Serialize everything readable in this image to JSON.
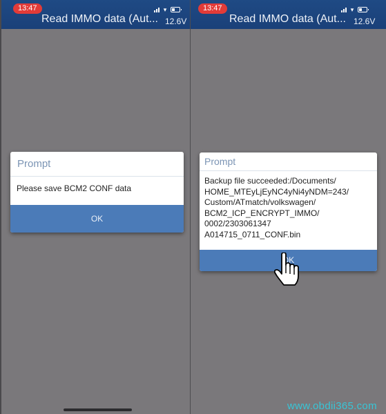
{
  "screens": [
    {
      "status": {
        "time": "13:47",
        "voltage": "12.6V",
        "icons": [
          "signal-icon",
          "wifi-icon",
          "battery-icon"
        ]
      },
      "header": {
        "title": "Read IMMO data (Aut..."
      },
      "dialog": {
        "title": "Prompt",
        "message": "Please save BCM2 CONF data",
        "ok_label": "OK"
      }
    },
    {
      "status": {
        "time": "13:47",
        "voltage": "12.6V",
        "icons": [
          "signal-icon",
          "wifi-icon",
          "battery-icon"
        ]
      },
      "header": {
        "title": "Read IMMO data (Aut..."
      },
      "dialog": {
        "title": "Prompt",
        "message_lines": [
          "Backup file succeeded:/Documents/",
          "HOME_MTEyLjEyNC4yNi4yNDM=243/",
          "Custom/ATmatch/volkswagen/",
          "BCM2_ICP_ENCRYPT_IMMO/",
          "0002/2303061347",
          "A014715_0711_CONF.bin"
        ],
        "ok_label": "OK"
      },
      "cursor": "hand-pointer-icon"
    }
  ],
  "watermark": "www.obdii365.com",
  "colors": {
    "header_blue": "#1d4680",
    "clock_red": "#e23b38",
    "button_blue": "#4b7bb8",
    "backdrop_gray": "#7a787b",
    "watermark_cyan": "#38c5d6"
  }
}
